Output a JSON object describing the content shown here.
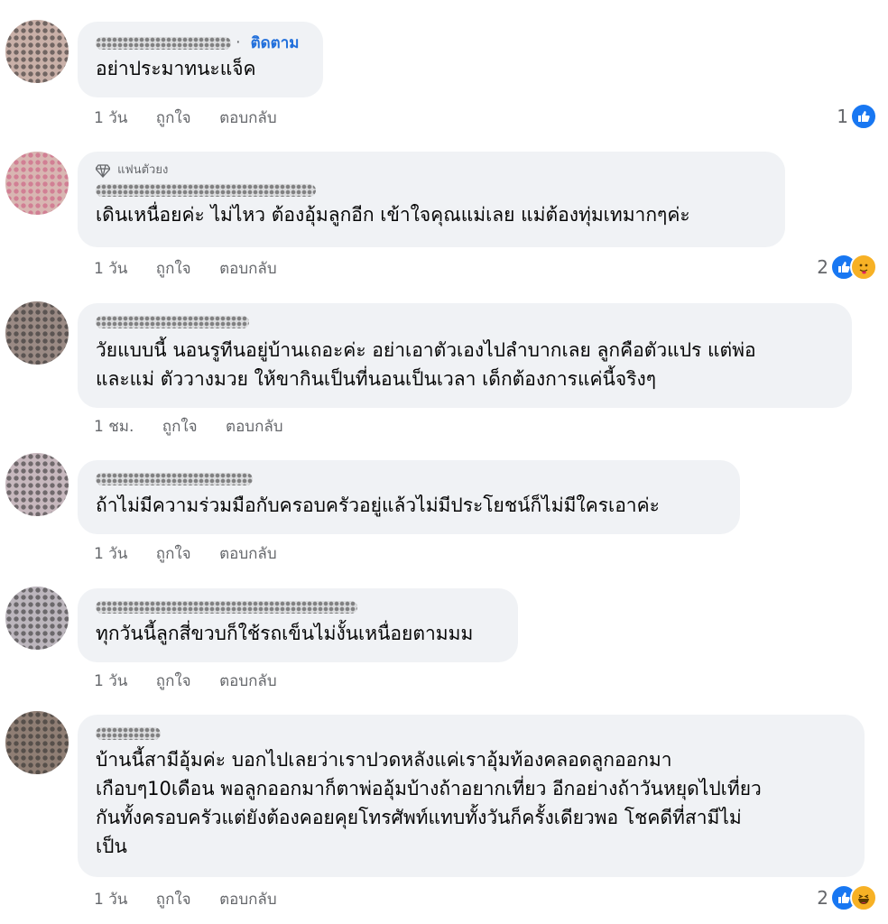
{
  "comments": [
    {
      "follow_label": "ติดตาม",
      "text_lines": [
        "อย่าประมาทนะแจ็ค"
      ],
      "time": "1 วัน",
      "like_label": "ถูกใจ",
      "reply_label": "ตอบกลับ",
      "reaction_count": "1",
      "reactions": [
        "like-icon"
      ]
    },
    {
      "badge": "แฟนตัวยง",
      "text_lines": [
        "เดินเหนื่อยค่ะ  ไม่ไหว ต้องอุ้มลูกอีก  เข้าใจคุณแม่เลย แม่ต้องทุ่มเทมากๆค่ะ"
      ],
      "time": "1 วัน",
      "like_label": "ถูกใจ",
      "reply_label": "ตอบกลับ",
      "reaction_count": "2",
      "reactions": [
        "like-icon",
        "care-icon"
      ]
    },
    {
      "text_lines": [
        "วัยแบบนี้ นอนรูทีนอยู่บ้านเถอะค่ะ อย่าเอาตัวเองไปลำบากเลย ลูกคือตัวแปร แต่พ่อ",
        "และแม่ ตัววางมวย  ให้ขากินเป็นที่นอนเป็นเวลา เด็กต้องการแค่นี้จริงๆ"
      ],
      "time": "1 ชม.",
      "like_label": "ถูกใจ",
      "reply_label": "ตอบกลับ"
    },
    {
      "text_lines": [
        "ถ้าไม่มีความร่วมมือกับครอบครัวอยู่แล้วไม่มีประโยชน์ก็ไม่มีใครเอาค่ะ"
      ],
      "time": "1 วัน",
      "like_label": "ถูกใจ",
      "reply_label": "ตอบกลับ"
    },
    {
      "text_lines": [
        "ทุกวันนี้ลูกสี่ขวบก็ใช้รถเข็นไม่งั้นเหนื่อยตามมม"
      ],
      "time": "1 วัน",
      "like_label": "ถูกใจ",
      "reply_label": "ตอบกลับ"
    },
    {
      "text_lines": [
        "บ้านนี้สามีอุ้มค่ะ บอกไปเลยว่าเราปวดหลังแค่เราอุ้มท้องคลอดลูกออกมา",
        "เกือบๆ10เดือน พอลูกออกมาก็ตาพ่ออุ้มบ้างถ้าอยากเที่ยว อีกอย่างถ้าวันหยุดไปเที่ยว",
        "กันทั้งครอบครัวแต่ยังต้องคอยคุยโทรศัพท์แทบทั้งวันก็ครั้งเดียวพอ โชคดีที่สามีไม่",
        "เป็น"
      ],
      "time": "1 วัน",
      "like_label": "ถูกใจ",
      "reply_label": "ตอบกลับ",
      "reaction_count": "2",
      "reactions": [
        "like-icon",
        "haha-icon"
      ]
    }
  ],
  "colors": {
    "bubble": "#f0f2f5",
    "follow": "#216fdb",
    "meta": "#65676b",
    "like": "#1877f2",
    "emoji": "#f7b125"
  }
}
